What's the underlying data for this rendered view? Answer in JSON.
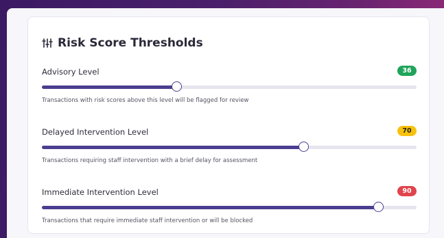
{
  "panel": {
    "title": "Risk Score Thresholds",
    "icon": "sliders-icon"
  },
  "thresholds": [
    {
      "label": "Advisory Level",
      "value": "36",
      "slider_value": 36,
      "badge_bg": "#1fa45a",
      "badge_fg": "#ffffff",
      "description": "Transactions with risk scores above this level will be flagged for review"
    },
    {
      "label": "Delayed Intervention Level",
      "value": "70",
      "slider_value": 70,
      "badge_bg": "#f6c20f",
      "badge_fg": "#2a2410",
      "description": "Transactions requiring staff intervention with a brief delay for assessment"
    },
    {
      "label": "Immediate Intervention Level",
      "value": "90",
      "slider_value": 90,
      "badge_bg": "#e0444c",
      "badge_fg": "#ffffff",
      "description": "Transactions that require immediate staff intervention or will be blocked"
    }
  ],
  "colors": {
    "accent": "#4b3d8f",
    "track": "#e6e4ec"
  }
}
